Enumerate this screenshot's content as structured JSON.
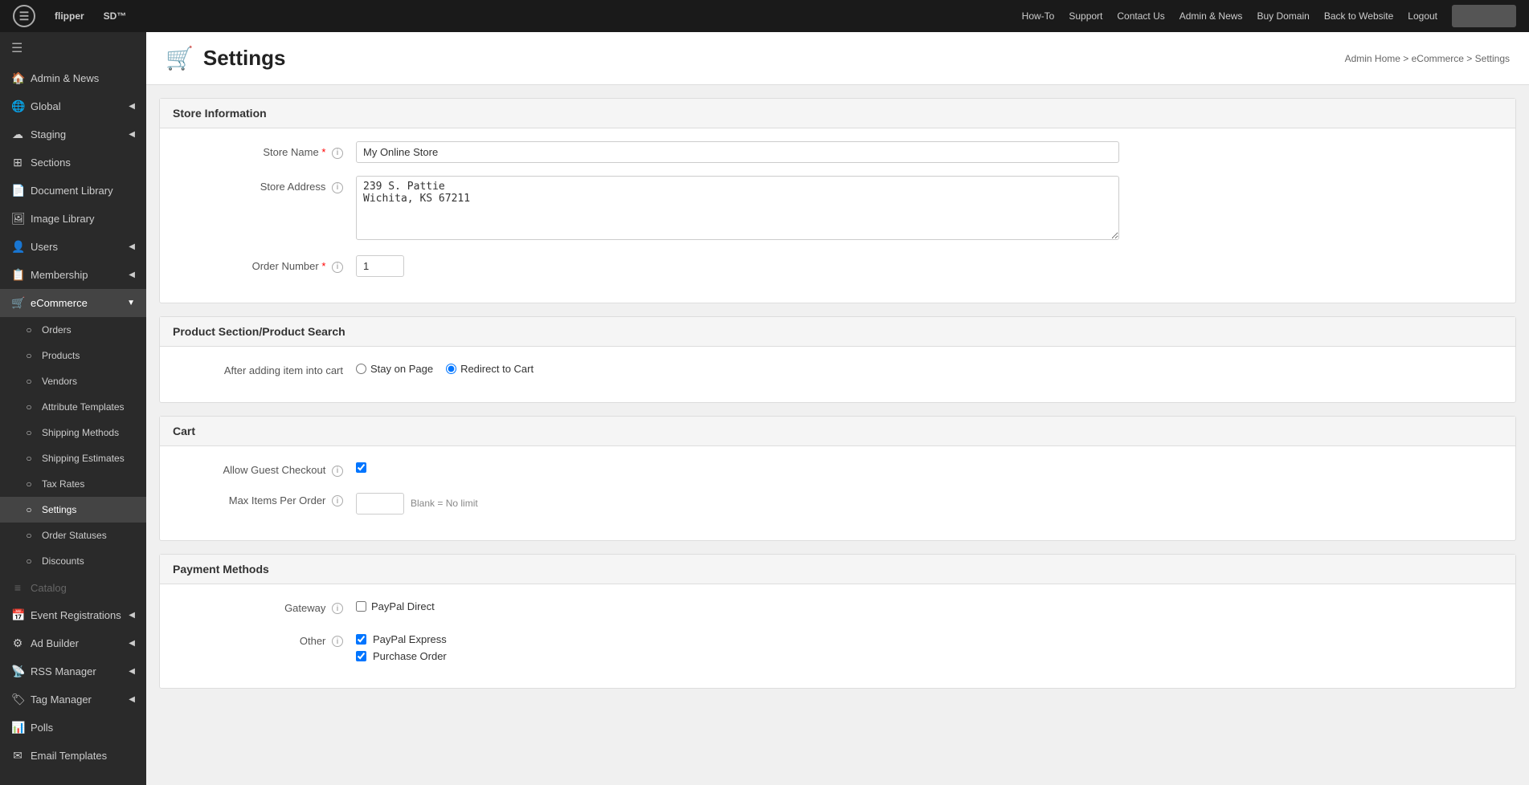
{
  "topNav": {
    "logo": "flipper",
    "logoSd": "SD™",
    "links": [
      "How-To",
      "Support",
      "Contact Us",
      "Admin & News",
      "Buy Domain",
      "Back to Website",
      "Logout"
    ]
  },
  "sidebar": {
    "hamburger": "≡",
    "items": [
      {
        "id": "admin-news",
        "label": "Admin & News",
        "icon": "🏠",
        "hasChevron": false,
        "active": false
      },
      {
        "id": "global",
        "label": "Global",
        "icon": "🌐",
        "hasChevron": true,
        "active": false
      },
      {
        "id": "staging",
        "label": "Staging",
        "icon": "☁",
        "hasChevron": true,
        "active": false
      },
      {
        "id": "sections",
        "label": "Sections",
        "icon": "⊞",
        "hasChevron": false,
        "active": false
      },
      {
        "id": "document-library",
        "label": "Document Library",
        "icon": "📄",
        "hasChevron": false,
        "active": false
      },
      {
        "id": "image-library",
        "label": "Image Library",
        "icon": "🖼",
        "hasChevron": false,
        "active": false
      },
      {
        "id": "users",
        "label": "Users",
        "icon": "👤",
        "hasChevron": true,
        "active": false
      },
      {
        "id": "membership",
        "label": "Membership",
        "icon": "📋",
        "hasChevron": true,
        "active": false
      },
      {
        "id": "ecommerce",
        "label": "eCommerce",
        "icon": "🛒",
        "hasChevron": true,
        "active": true
      },
      {
        "id": "orders",
        "label": "Orders",
        "icon": "○",
        "sub": true,
        "active": false
      },
      {
        "id": "products",
        "label": "Products",
        "icon": "○",
        "sub": true,
        "active": false
      },
      {
        "id": "vendors",
        "label": "Vendors",
        "icon": "○",
        "sub": true,
        "active": false
      },
      {
        "id": "attribute-templates",
        "label": "Attribute Templates",
        "icon": "○",
        "sub": true,
        "active": false
      },
      {
        "id": "shipping-methods",
        "label": "Shipping Methods",
        "icon": "○",
        "sub": true,
        "active": false
      },
      {
        "id": "shipping-estimates",
        "label": "Shipping Estimates",
        "icon": "○",
        "sub": true,
        "active": false
      },
      {
        "id": "tax-rates",
        "label": "Tax Rates",
        "icon": "○",
        "sub": true,
        "active": false
      },
      {
        "id": "settings",
        "label": "Settings",
        "icon": "○",
        "sub": true,
        "active": true
      },
      {
        "id": "order-statuses",
        "label": "Order Statuses",
        "icon": "○",
        "sub": true,
        "active": false
      },
      {
        "id": "discounts",
        "label": "Discounts",
        "icon": "○",
        "sub": true,
        "active": false
      },
      {
        "id": "catalog",
        "label": "Catalog",
        "icon": "≡",
        "sub": false,
        "active": false,
        "grayed": true
      },
      {
        "id": "event-registrations",
        "label": "Event Registrations",
        "icon": "📅",
        "hasChevron": true,
        "active": false
      },
      {
        "id": "ad-builder",
        "label": "Ad Builder",
        "icon": "⚙",
        "hasChevron": true,
        "active": false
      },
      {
        "id": "rss-manager",
        "label": "RSS Manager",
        "icon": "📡",
        "hasChevron": true,
        "active": false
      },
      {
        "id": "tag-manager",
        "label": "Tag Manager",
        "icon": "🏷",
        "hasChevron": true,
        "active": false
      },
      {
        "id": "polls",
        "label": "Polls",
        "icon": "📊",
        "active": false
      },
      {
        "id": "email-templates",
        "label": "Email Templates",
        "icon": "✉",
        "active": false
      }
    ]
  },
  "page": {
    "titleIcon": "🛒",
    "title": "Settings",
    "breadcrumb": "Admin Home > eCommerce > Settings"
  },
  "sections": {
    "storeInfo": {
      "header": "Store Information",
      "fields": {
        "storeName": {
          "label": "Store Name",
          "required": true,
          "value": "My Online Store"
        },
        "storeAddress": {
          "label": "Store Address",
          "value": "239 S. Pattie\nWichita, KS 67211"
        },
        "orderNumber": {
          "label": "Order Number",
          "required": true,
          "value": "1"
        }
      }
    },
    "productSection": {
      "header": "Product Section/Product Search",
      "fields": {
        "afterAddingItem": {
          "label": "After adding item into cart",
          "options": [
            {
              "label": "Stay on Page",
              "value": "stay",
              "checked": false
            },
            {
              "label": "Redirect to Cart",
              "value": "redirect",
              "checked": true
            }
          ]
        }
      }
    },
    "cart": {
      "header": "Cart",
      "fields": {
        "allowGuestCheckout": {
          "label": "Allow Guest Checkout",
          "checked": true
        },
        "maxItemsPerOrder": {
          "label": "Max Items Per Order",
          "value": "",
          "hint": "Blank = No limit"
        }
      }
    },
    "paymentMethods": {
      "header": "Payment Methods",
      "fields": {
        "gateway": {
          "label": "Gateway",
          "options": [
            {
              "label": "PayPal Direct",
              "checked": false
            }
          ]
        },
        "other": {
          "label": "Other",
          "options": [
            {
              "label": "PayPal Express",
              "checked": true
            },
            {
              "label": "Purchase Order",
              "checked": true
            }
          ]
        }
      }
    }
  }
}
